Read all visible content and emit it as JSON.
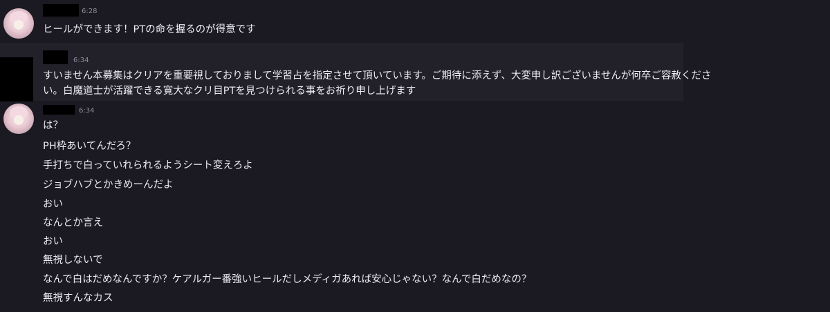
{
  "messages": [
    {
      "avatar": "girl-avatar",
      "time": "6:28",
      "lines": [
        "ヒールができます！PTの命を握るのが得意です"
      ]
    },
    {
      "avatar": "black-avatar",
      "time": "6:34",
      "lines": [
        "すいません本募集はクリアを重要視しておりまして学習占を指定させて頂いています。ご期待に添えず、大変申し訳ございませんが何卒ご容赦くださ",
        "い。白魔道士が活躍できる寛大なクリ目PTを見つけられる事をお祈り申し上げます"
      ]
    },
    {
      "avatar": "girl-avatar",
      "time": "6:34",
      "lines": [
        "は？",
        "PH枠あいてんだろ？",
        "手打ちで白っていれられるようシート変えろよ",
        "ジョブハブとかきめーんだよ",
        "おい",
        "なんとか言え",
        "おい",
        "無視しないで",
        "なんで白はだめなんですか？ケアルガー番強いヒールだしメディガあれば安心じゃない？なんで白だめなの？",
        "無視すんなカス"
      ]
    }
  ]
}
